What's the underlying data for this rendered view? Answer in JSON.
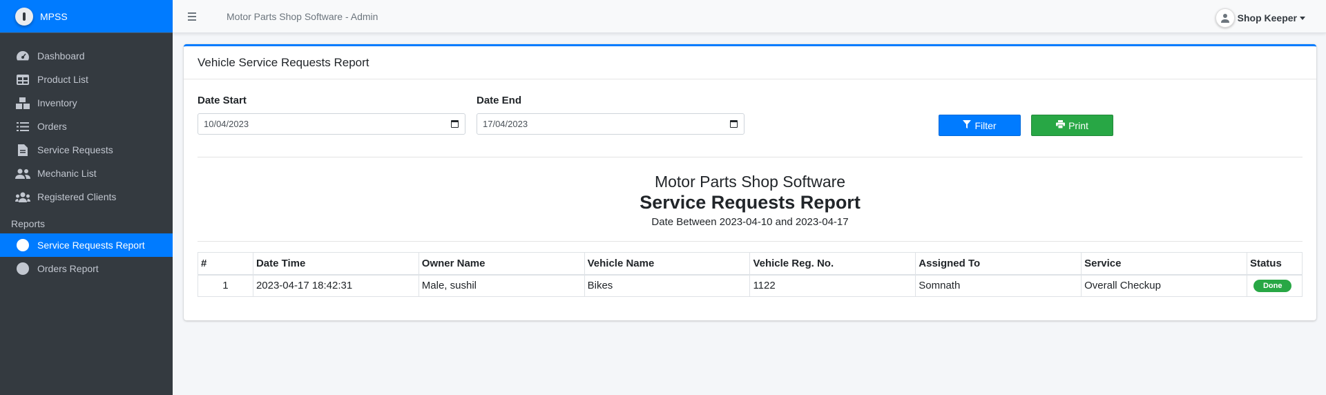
{
  "sidebar": {
    "brand": "MPSS",
    "items": [
      {
        "label": "Dashboard",
        "icon": "dashboard-icon"
      },
      {
        "label": "Product List",
        "icon": "table-icon"
      },
      {
        "label": "Inventory",
        "icon": "boxes-icon"
      },
      {
        "label": "Orders",
        "icon": "list-check-icon"
      },
      {
        "label": "Service Requests",
        "icon": "file-icon"
      },
      {
        "label": "Mechanic List",
        "icon": "users-icon"
      },
      {
        "label": "Registered Clients",
        "icon": "users-group-icon"
      }
    ],
    "reports_header": "Reports",
    "report_items": [
      {
        "label": "Service Requests Report",
        "active": true
      },
      {
        "label": "Orders Report",
        "active": false
      }
    ]
  },
  "topbar": {
    "title": "Motor Parts Shop Software - Admin",
    "user": "Shop Keeper"
  },
  "card": {
    "title": "Vehicle Service Requests Report",
    "date_start_label": "Date Start",
    "date_start_value": "10/04/2023",
    "date_end_label": "Date End",
    "date_end_value": "17/04/2023",
    "filter_label": "Filter",
    "print_label": "Print"
  },
  "report": {
    "shop_name": "Motor Parts Shop Software",
    "title": "Service Requests Report",
    "date_range": "Date Between 2023-04-10 and 2023-04-17",
    "columns": [
      "#",
      "Date Time",
      "Owner Name",
      "Vehicle Name",
      "Vehicle Reg. No.",
      "Assigned To",
      "Service",
      "Status"
    ],
    "rows": [
      {
        "num": "1",
        "datetime": "2023-04-17 18:42:31",
        "owner": "Male, sushil",
        "vehicle": "Bikes",
        "reg": "1122",
        "assigned": "Somnath",
        "service": "Overall Checkup",
        "status": "Done"
      }
    ]
  },
  "colors": {
    "primary": "#007bff",
    "success": "#28a745",
    "sidebar": "#343a40"
  }
}
